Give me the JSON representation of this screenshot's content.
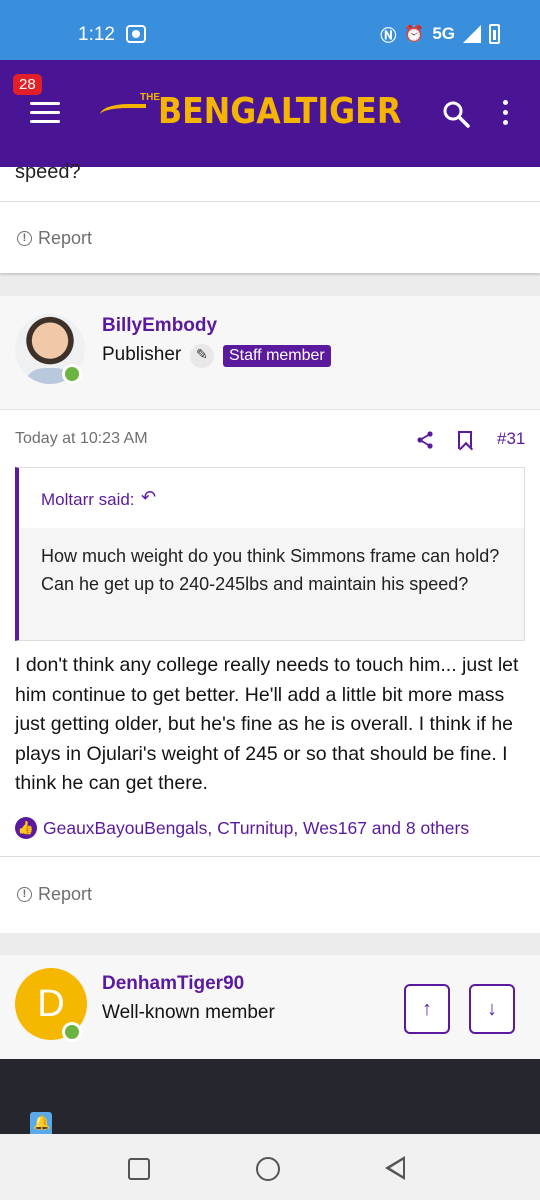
{
  "status_bar": {
    "time": "1:12",
    "network": "5G"
  },
  "header": {
    "notification_count": "28",
    "logo_the": "THE",
    "logo_bengal": "BENGAL",
    "logo_tiger": "TIGER"
  },
  "prev_post": {
    "tail_text": "speed?",
    "report_label": "Report"
  },
  "post": {
    "author": "BillyEmbody",
    "title": "Publisher",
    "staff_badge": "Staff member",
    "date": "Today at 10:23 AM",
    "number": "#31",
    "quote": {
      "author": "Moltarr said:",
      "text": "How much weight do you think Simmons frame can hold? Can he get up to 240-245lbs and maintain his speed?"
    },
    "body": "I don't think any college really needs to touch him... just let him continue to get better. He'll add a little bit more mass just getting older, but he's fine as he is overall. I think if he plays in Ojulari's weight of 245 or so that should be fine. I think he can get there.",
    "reactions": "GeauxBayouBengals, CTurnitup, Wes167 and 8 others",
    "report_label": "Report"
  },
  "next_post": {
    "avatar_letter": "D",
    "author": "DenhamTiger90",
    "title": "Well-known member"
  },
  "colors": {
    "brand_purple": "#4a1594",
    "accent_gold": "#f5b400",
    "link_purple": "#5b1a9e",
    "status_blue": "#3a8fdc"
  }
}
